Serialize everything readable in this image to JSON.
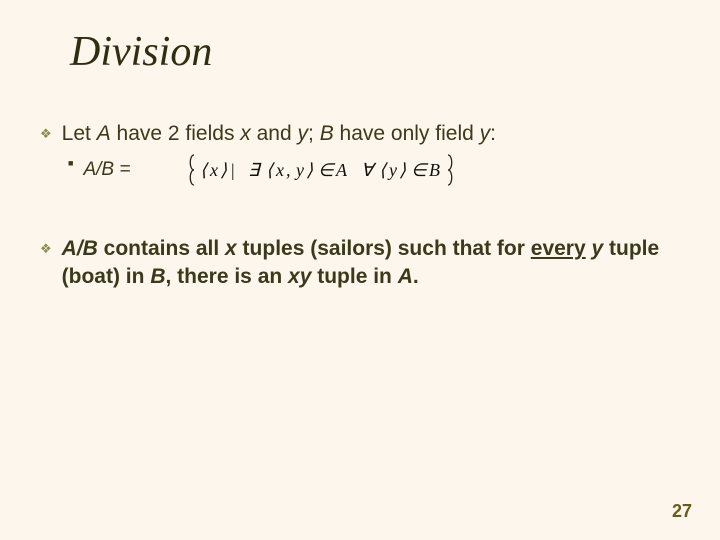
{
  "title": "Division",
  "b1": {
    "pre": "Let ",
    "A": "A",
    "mid1": " have 2 fields ",
    "x": "x",
    "and": " and ",
    "y1": "y",
    "mid2": ";   ",
    "B": "B",
    "mid3": " have only field ",
    "y2": "y",
    "post": ":"
  },
  "sub1": {
    "lhs": "A/B ="
  },
  "b2": {
    "t1": "A/B",
    "t2": " contains all ",
    "t3": "x",
    "t4": " tuples (sailors) such that for ",
    "t5": "every",
    "t6": " ",
    "t7": "y",
    "t8": " tuple (boat) in ",
    "t9": "B",
    "t10": ", there is an ",
    "t11": "xy",
    "t12": " tuple in ",
    "t13": "A",
    "t14": "."
  },
  "pageNumber": "27"
}
